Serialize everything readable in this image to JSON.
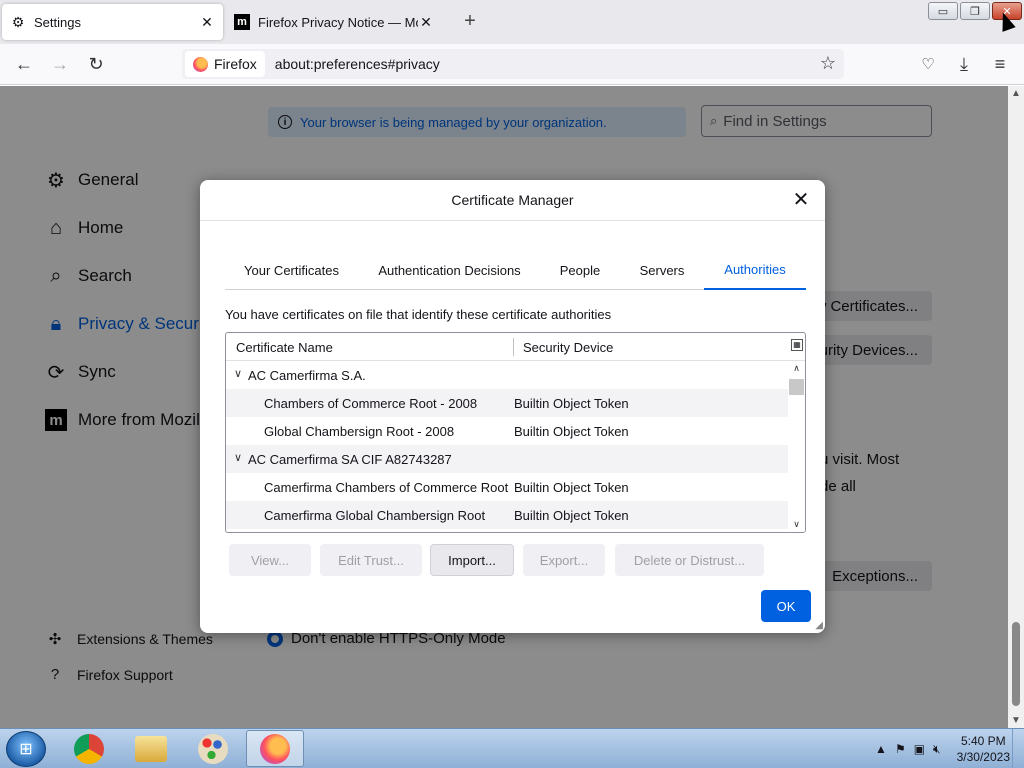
{
  "tabs": [
    {
      "label": "Settings",
      "icon": "gear-icon",
      "active": true
    },
    {
      "label": "Firefox Privacy Notice — Mozilla",
      "icon": "mozilla-m-icon",
      "active": false
    }
  ],
  "window_controls": {
    "minimize": "▭",
    "restore": "❐",
    "close": "✕"
  },
  "navbar": {
    "identity_label": "Firefox",
    "url": "about:preferences#privacy"
  },
  "settings_page": {
    "managed_notice": "Your browser is being managed by your organization.",
    "find_placeholder": "Find in Settings",
    "categories": [
      {
        "label": "General",
        "icon": "gear-icon"
      },
      {
        "label": "Home",
        "icon": "home-icon"
      },
      {
        "label": "Search",
        "icon": "search-icon"
      },
      {
        "label": "Privacy & Security",
        "icon": "lock-icon",
        "selected": true
      },
      {
        "label": "Sync",
        "icon": "sync-icon"
      },
      {
        "label": "More from Mozilla",
        "icon": "mozilla-m-icon"
      }
    ],
    "footer_links": [
      {
        "label": "Extensions & Themes",
        "icon": "puzzle-icon"
      },
      {
        "label": "Firefox Support",
        "icon": "help-icon"
      }
    ],
    "view_certificates_label": "View Certificates...",
    "security_devices_label": "Security Devices...",
    "partial_text_1": "u visit. Most",
    "partial_text_2": "de all",
    "exceptions_label": "Exceptions...",
    "https_only_radio": "Don't enable HTTPS-Only Mode"
  },
  "dialog": {
    "title": "Certificate Manager",
    "tabs": [
      {
        "label": "Your Certificates"
      },
      {
        "label": "Authentication Decisions"
      },
      {
        "label": "People"
      },
      {
        "label": "Servers"
      },
      {
        "label": "Authorities",
        "active": true
      }
    ],
    "description": "You have certificates on file that identify these certificate authorities",
    "columns": {
      "name": "Certificate Name",
      "device": "Security Device"
    },
    "rows": [
      {
        "type": "group",
        "name": "AC Camerfirma S.A.",
        "device": ""
      },
      {
        "type": "child",
        "name": "Chambers of Commerce Root - 2008",
        "device": "Builtin Object Token"
      },
      {
        "type": "child",
        "name": "Global Chambersign Root - 2008",
        "device": "Builtin Object Token"
      },
      {
        "type": "group",
        "name": "AC Camerfirma SA CIF A82743287",
        "device": ""
      },
      {
        "type": "child",
        "name": "Camerfirma Chambers of Commerce Root",
        "device": "Builtin Object Token"
      },
      {
        "type": "child",
        "name": "Camerfirma Global Chambersign Root",
        "device": "Builtin Object Token"
      }
    ],
    "buttons": {
      "view": "View...",
      "edit_trust": "Edit Trust...",
      "import": "Import...",
      "export": "Export...",
      "delete": "Delete or Distrust...",
      "ok": "OK"
    }
  },
  "taskbar": {
    "apps": [
      "windows-start",
      "chrome",
      "file-explorer",
      "paint",
      "firefox"
    ],
    "time": "5:40 PM",
    "date": "3/30/2023"
  },
  "colors": {
    "accent": "#0061e0",
    "overlay": "rgba(0,0,0,0.45)"
  }
}
